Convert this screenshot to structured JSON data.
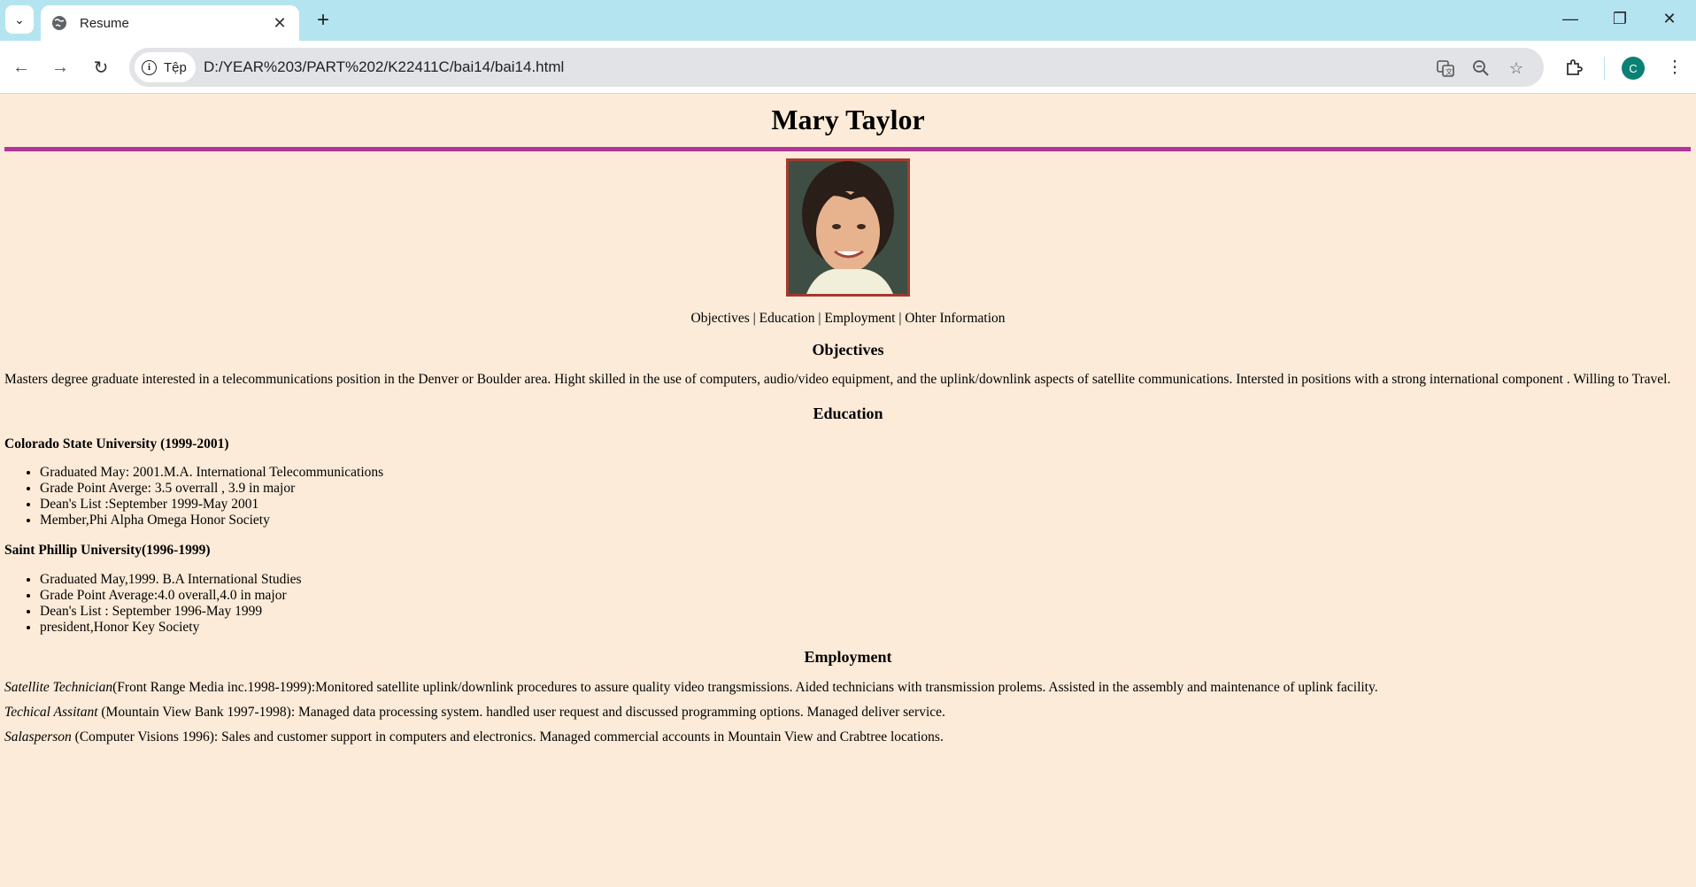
{
  "browser": {
    "tab_title": "Resume",
    "new_tab": "+",
    "chip_label": "Tệp",
    "url": "D:/YEAR%203/PART%202/K22411C/bai14/bai14.html",
    "avatar_letter": "C"
  },
  "resume": {
    "name": "Mary Taylor",
    "nav": {
      "objectives": "Objectives",
      "education": "Education",
      "employment": "Employment",
      "other": "Ohter Information",
      "separator": "|"
    },
    "objectives": {
      "heading": "Objectives",
      "text": "Masters degree graduate interested in a telecommunications position in the Denver or Boulder area. Hight skilled in the use of computers, audio/video equipment, and the uplink/downlink aspects of satellite communications. Intersted in positions with a strong international component . Willing to Travel."
    },
    "education": {
      "heading": "Education",
      "schools": [
        {
          "name": "Colorado State University (1999-2001)",
          "items": [
            "Graduated May: 2001.M.A. International Telecommunications",
            "Grade Point Averge: 3.5 overrall , 3.9 in major",
            "Dean's List :September 1999-May 2001",
            "Member,Phi Alpha Omega Honor Society"
          ]
        },
        {
          "name": "Saint Phillip University(1996-1999)",
          "items": [
            "Graduated May,1999. B.A International Studies",
            "Grade Point Average:4.0 overall,4.0 in major",
            "Dean's List : September 1996-May 1999",
            "president,Honor Key Society"
          ]
        }
      ]
    },
    "employment": {
      "heading": "Employment",
      "jobs": [
        {
          "title": "Satellite Technician",
          "desc": "(Front Range Media inc.1998-1999):Monitored satellite uplink/downlink procedures to assure quality video trangsmissions. Aided technicians with transmission prolems. Assisted in the assembly and maintenance of uplink facility."
        },
        {
          "title": "Techical Assitant",
          "desc": " (Mountain View Bank 1997-1998): Managed data processing system. handled user request and discussed programming options. Managed deliver service."
        },
        {
          "title": "Salasperson",
          "desc": " (Computer Visions 1996): Sales and customer support in computers and electronics. Managed commercial accounts in Mountain View and Crabtree locations."
        }
      ]
    }
  },
  "colors": {
    "page_bg": "#fcebd8",
    "rule": "#b0369c",
    "photo_border": "#a13a2e",
    "tabbar_bg": "#b5e4f1"
  },
  "icons": [
    "tab-search-icon",
    "globe-icon",
    "close-icon",
    "back-arrow-icon",
    "forward-arrow-icon",
    "reload-icon",
    "info-icon",
    "translate-icon",
    "zoom-icon",
    "star-icon",
    "extensions-icon",
    "kebab-menu-icon",
    "minimize-icon",
    "restore-icon",
    "window-close-icon"
  ]
}
